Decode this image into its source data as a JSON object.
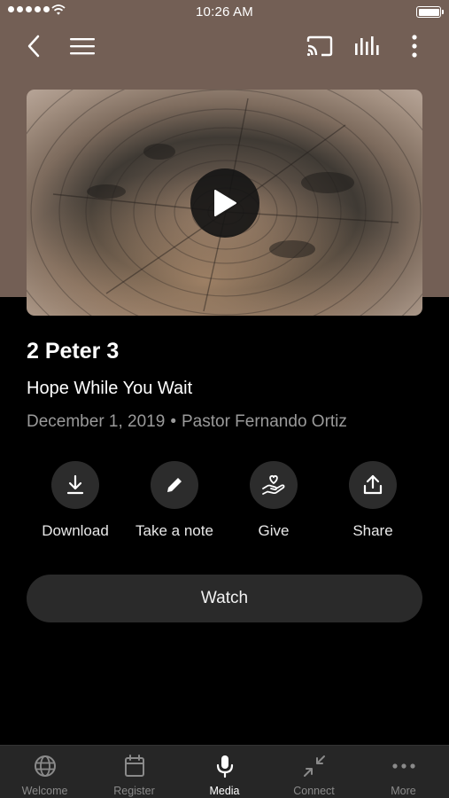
{
  "status_bar": {
    "time": "10:26 AM"
  },
  "toolbar": {
    "back_icon": "chevron-left-icon",
    "menu_icon": "hamburger-menu-icon",
    "cast_icon": "cast-icon",
    "audio_icon": "audio-bars-icon",
    "more_icon": "vertical-dots-icon"
  },
  "media": {
    "title": "2 Peter 3",
    "subtitle": "Hope While You Wait",
    "date": "December 1, 2019",
    "separator": "•",
    "speaker": "Pastor Fernando Ortiz",
    "play_icon": "play-icon"
  },
  "actions": [
    {
      "label": "Download",
      "icon": "download-icon"
    },
    {
      "label": "Take a note",
      "icon": "pencil-icon"
    },
    {
      "label": "Give",
      "icon": "give-hand-heart-icon"
    },
    {
      "label": "Share",
      "icon": "share-icon"
    }
  ],
  "watch_button": {
    "label": "Watch"
  },
  "tabs": [
    {
      "label": "Welcome",
      "icon": "globe-icon",
      "active": false
    },
    {
      "label": "Register",
      "icon": "calendar-icon",
      "active": false
    },
    {
      "label": "Media",
      "icon": "microphone-icon",
      "active": true
    },
    {
      "label": "Connect",
      "icon": "connect-arrows-icon",
      "active": false
    },
    {
      "label": "More",
      "icon": "more-dots-icon",
      "active": false
    }
  ],
  "colors": {
    "hero_background": "#735f55",
    "page_background": "#000000",
    "button_background": "#2a2a2a",
    "tabbar_background": "#262626",
    "meta_text": "#9a9a9a"
  }
}
